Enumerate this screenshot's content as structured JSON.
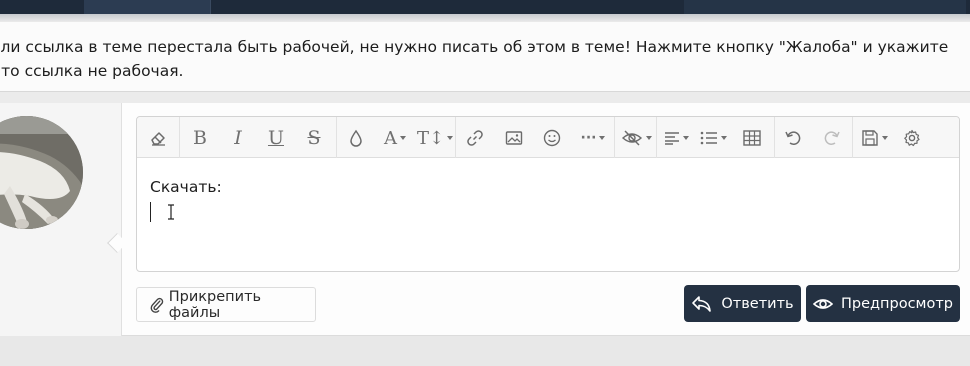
{
  "notice": {
    "text": "сли ссылка в теме перестала быть рабочей, не нужно писать об этом в теме! Нажмите кнопку \"Жалоба\" и укажите что ссылка не рабочая."
  },
  "avatar": {
    "icon": "user-avatar-cat-photo"
  },
  "toolbar": {
    "buttons": [
      {
        "name": "eraser-icon"
      },
      {
        "name": "bold-icon",
        "label": "B"
      },
      {
        "name": "italic-icon",
        "label": "I"
      },
      {
        "name": "underline-icon",
        "label": "U"
      },
      {
        "name": "strikethrough-icon",
        "label": "S"
      },
      {
        "name": "color-drop-icon"
      },
      {
        "name": "font-family-icon",
        "label": "A"
      },
      {
        "name": "font-size-icon",
        "label": "T"
      },
      {
        "name": "link-icon"
      },
      {
        "name": "image-icon"
      },
      {
        "name": "smiley-icon"
      },
      {
        "name": "more-icon",
        "label": "···"
      },
      {
        "name": "hide-content-icon"
      },
      {
        "name": "align-icon"
      },
      {
        "name": "list-icon"
      },
      {
        "name": "table-icon"
      },
      {
        "name": "undo-icon"
      },
      {
        "name": "redo-icon"
      },
      {
        "name": "drafts-icon"
      },
      {
        "name": "settings-gear-icon"
      }
    ]
  },
  "editor": {
    "content": "Скачать:"
  },
  "actions": {
    "attach_label": "Прикрепить файлы",
    "reply_label": "Ответить",
    "preview_label": "Предпросмотр"
  },
  "colors": {
    "primary_button": "#243142",
    "topbar": "#1e2a3a"
  }
}
